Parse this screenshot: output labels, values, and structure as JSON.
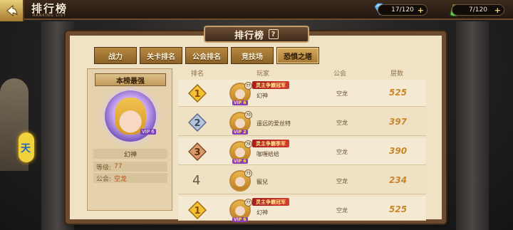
{
  "header": {
    "title": "排行榜",
    "subtitle": "RANKING LIST",
    "gems": "17/120",
    "stamina": "7/120"
  },
  "panel": {
    "title": "排行榜"
  },
  "tabs": [
    {
      "label": "战力",
      "active": false
    },
    {
      "label": "关卡排名",
      "active": false
    },
    {
      "label": "公会排名",
      "active": false
    },
    {
      "label": "竞技场",
      "active": false
    },
    {
      "label": "恐惧之塔",
      "active": true
    }
  ],
  "best": {
    "header": "本榜最强",
    "name": "幻神",
    "level_label": "等级:",
    "level_value": "77",
    "guild_label": "公会:",
    "guild_value": "空龙",
    "vip": "VIP 6"
  },
  "table": {
    "headers": [
      "排名",
      "玩家",
      "公会",
      "层数"
    ],
    "rows": [
      {
        "rank": "1",
        "player": "幻神",
        "title": "灵主争霸冠军",
        "guild": "空龙",
        "floor": "525",
        "vip": "VIP 6",
        "level": "77"
      },
      {
        "rank": "2",
        "player": "遥远的爱丝特",
        "title": "",
        "guild": "空龙",
        "floor": "397",
        "vip": "VIP 2",
        "level": "70"
      },
      {
        "rank": "3",
        "player": "咖喱给给",
        "title": "灵主争霸季军",
        "guild": "空龙",
        "floor": "390",
        "vip": "VIP 6",
        "level": "76"
      },
      {
        "rank": "4",
        "player": "寵兒",
        "title": "",
        "guild": "空龙",
        "floor": "234",
        "vip": "",
        "level": "73"
      },
      {
        "rank": "1",
        "player": "幻神",
        "title": "灵主争霸冠军",
        "guild": "空龙",
        "floor": "525",
        "vip": "VIP 6",
        "level": "77"
      }
    ]
  },
  "colors": {
    "gold": "#d7aa5a",
    "silver": "#a6b1c8",
    "bronze": "#c98b57",
    "floor": "#c9862a"
  }
}
